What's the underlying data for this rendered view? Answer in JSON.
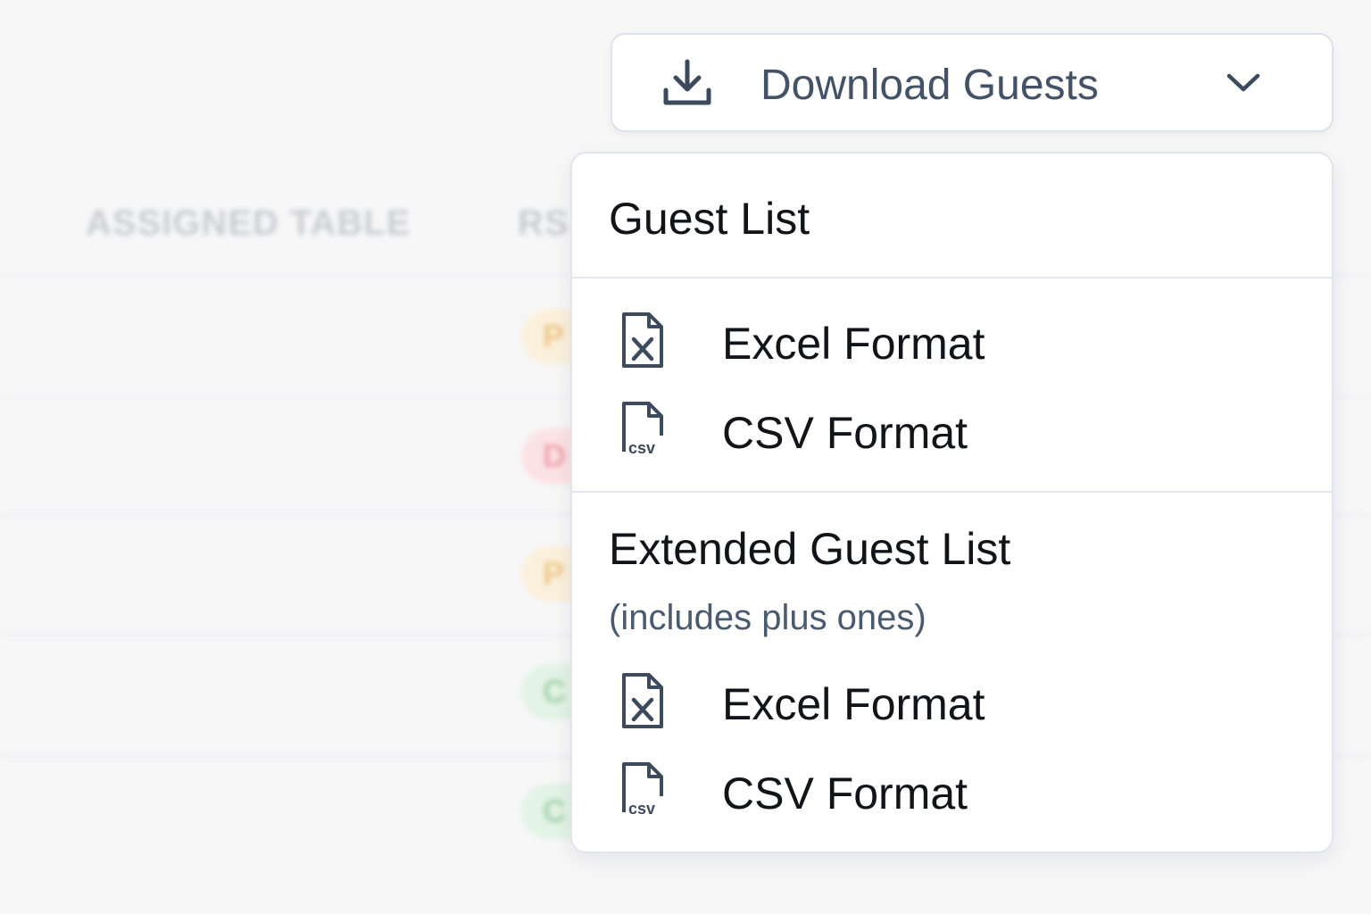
{
  "background_table": {
    "headers": [
      "ASSIGNED TABLE",
      "RS"
    ],
    "badges": [
      {
        "text": "P",
        "status": "warn"
      },
      {
        "text": "D",
        "status": "danger"
      },
      {
        "text": "P",
        "status": "warn"
      },
      {
        "text": "C",
        "status": "ok"
      },
      {
        "text": "C",
        "status": "ok"
      }
    ]
  },
  "download_button": {
    "label": "Download Guests",
    "icon": "download-icon",
    "chevron": "chevron-down-icon"
  },
  "dropdown": {
    "sections": [
      {
        "title": "Guest List",
        "subtitle": "",
        "items": [
          {
            "label": "Excel Format",
            "icon": "excel-file-icon"
          },
          {
            "label": "CSV Format",
            "icon": "csv-file-icon"
          }
        ]
      },
      {
        "title": "Extended Guest List",
        "subtitle": "(includes plus ones)",
        "items": [
          {
            "label": "Excel Format",
            "icon": "excel-file-icon"
          },
          {
            "label": "CSV Format",
            "icon": "csv-file-icon"
          }
        ]
      }
    ]
  },
  "colors": {
    "accent_text": "#435266",
    "border": "#dde3ec",
    "icon_stroke": "#3d4a5c"
  }
}
